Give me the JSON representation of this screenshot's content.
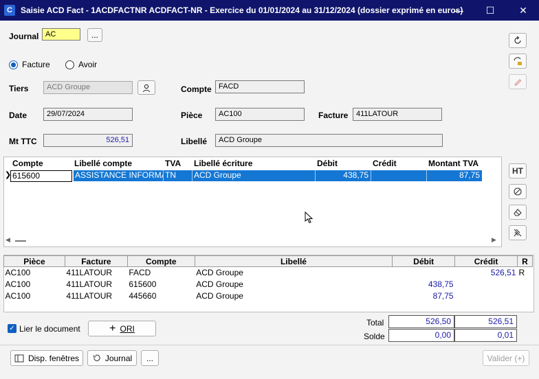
{
  "window": {
    "title": "Saisie ACD Fact - 1ACDFACTNR ACDFACT-NR - Exercice du 01/01/2024 au 31/12/2024 (dossier exprimé en euros)",
    "app_icon_letter": "C"
  },
  "header": {
    "journal_label": "Journal",
    "journal_value": "AC",
    "journal_more_button": "...",
    "radio_facture": "Facture",
    "radio_avoir": "Avoir",
    "selected_type": "Facture",
    "tiers_label": "Tiers",
    "tiers_value": "ACD Groupe",
    "compte_label": "Compte",
    "compte_value": "FACD",
    "date_label": "Date",
    "date_value": "29/07/2024",
    "piece_label": "Pièce",
    "piece_value": "AC100",
    "facture_label": "Facture",
    "facture_value": "411LATOUR",
    "mt_ttc_label": "Mt TTC",
    "mt_ttc_value": "526,51",
    "libelle_label": "Libellé",
    "libelle_value": "ACD Groupe"
  },
  "entry_grid": {
    "columns": [
      "Compte",
      "Libellé compte",
      "TVA",
      "Libellé écriture",
      "Débit",
      "Crédit",
      "Montant TVA"
    ],
    "row": {
      "compte": "615600",
      "libelle_compte": "ASSISTANCE INFORMATIQUE",
      "tva": "TN",
      "libelle_ecriture": "ACD Groupe",
      "debit": "438,75",
      "credit": "",
      "montant_tva": "87,75"
    },
    "ht_button": "HT"
  },
  "lines_table": {
    "columns": [
      "Pièce",
      "Facture",
      "Compte",
      "Libellé",
      "Débit",
      "Crédit",
      "R"
    ],
    "rows": [
      {
        "piece": "AC100",
        "facture": "411LATOUR",
        "compte": "FACD",
        "libelle": "ACD Groupe",
        "debit": "",
        "credit": "526,51",
        "r": "R"
      },
      {
        "piece": "AC100",
        "facture": "411LATOUR",
        "compte": "615600",
        "libelle": "ACD Groupe",
        "debit": "438,75",
        "credit": "",
        "r": ""
      },
      {
        "piece": "AC100",
        "facture": "411LATOUR",
        "compte": "445660",
        "libelle": "ACD Groupe",
        "debit": "87,75",
        "credit": "",
        "r": ""
      }
    ]
  },
  "footer": {
    "lier_document_label": "Lier le document",
    "lier_document_checked": true,
    "ori_button": "ORI",
    "total_label": "Total",
    "total_debit": "526,50",
    "total_credit": "526,51",
    "solde_label": "Solde",
    "solde_debit": "0,00",
    "solde_credit": "0,01",
    "disp_fenetres_button": "Disp. fenêtres",
    "journal_button": "Journal",
    "more_button": "...",
    "valider_button": "Valider (+)"
  },
  "colors": {
    "titlebar": "#10156b",
    "selection": "#1477d4",
    "journal_field": "#ffff8c",
    "amount_text": "#1a1aa6"
  }
}
